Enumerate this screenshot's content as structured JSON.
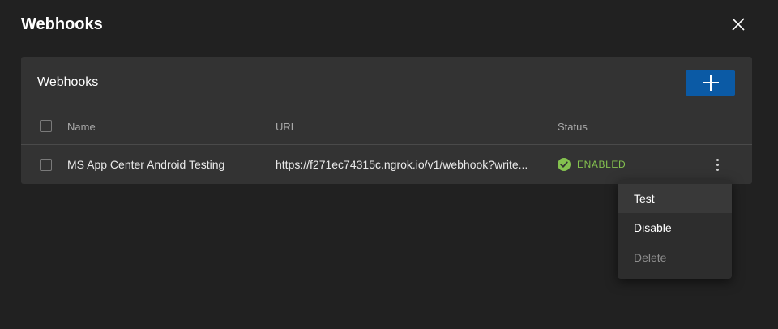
{
  "page": {
    "title": "Webhooks"
  },
  "card": {
    "title": "Webhooks",
    "table": {
      "columns": [
        "Name",
        "URL",
        "Status"
      ],
      "rows": [
        {
          "name": "MS App Center Android Testing",
          "url": "https://f271ec74315c.ngrok.io/v1/webhook?write...",
          "status": "ENABLED"
        }
      ]
    }
  },
  "context_menu": {
    "items": [
      {
        "label": "Test",
        "state": "hovered"
      },
      {
        "label": "Disable",
        "state": "normal"
      },
      {
        "label": "Delete",
        "state": "disabled"
      }
    ]
  },
  "icons": {
    "close": "close-icon",
    "add": "plus-icon",
    "status": "check-circle-icon",
    "more": "more-vertical-icon"
  },
  "colors": {
    "background": "#212121",
    "card": "#333333",
    "primary_button": "#0b5aa5",
    "enabled": "#84c14f",
    "menu": "#2d2d2d"
  }
}
